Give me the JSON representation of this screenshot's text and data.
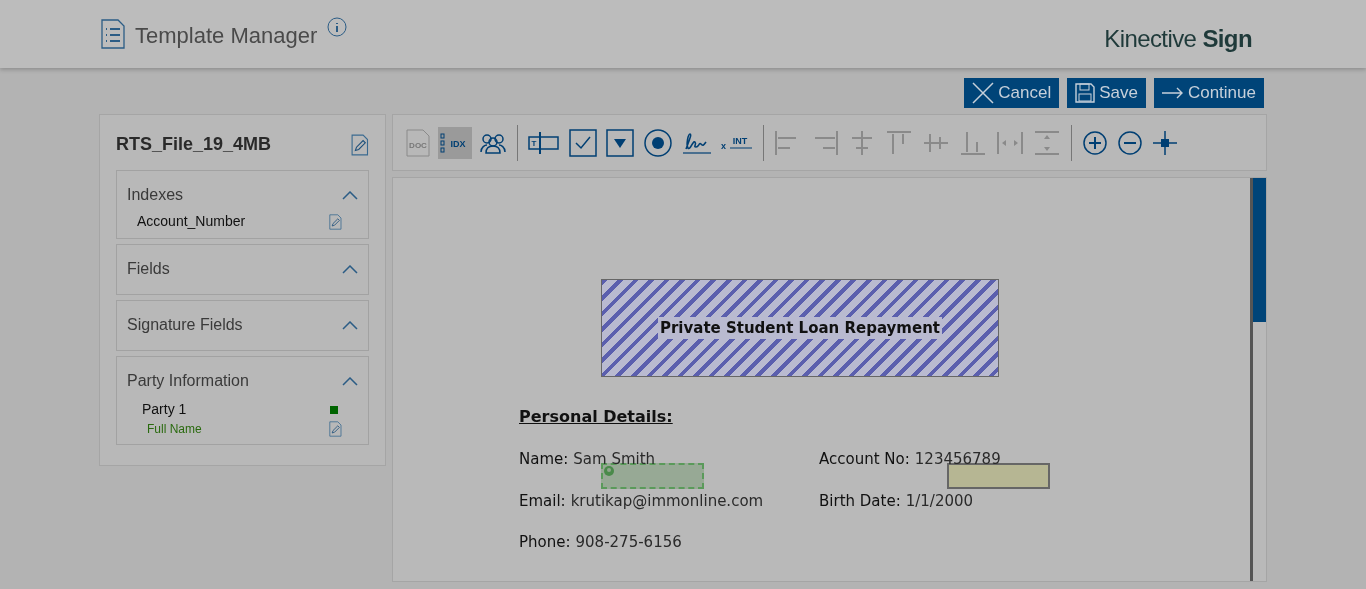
{
  "header": {
    "title": "Template Manager",
    "brand": {
      "light": "Kinective",
      "bold": "Sign"
    }
  },
  "actions": [
    {
      "kind": "cancel",
      "label": "Cancel"
    },
    {
      "kind": "save",
      "label": "Save"
    },
    {
      "kind": "continue",
      "label": "Continue"
    }
  ],
  "sidebar": {
    "file_name": "RTS_File_19_4MB",
    "sections": [
      {
        "title": "Indexes",
        "expanded": true,
        "items": [
          {
            "kind": "index",
            "label": "Account_Number"
          }
        ]
      },
      {
        "title": "Fields",
        "expanded": true
      },
      {
        "title": "Signature Fields",
        "expanded": true
      },
      {
        "title": "Party Information",
        "expanded": true,
        "items": [
          {
            "kind": "party",
            "label": "Party 1",
            "color": "#006400"
          },
          {
            "kind": "party-field",
            "label": "Full Name"
          }
        ]
      }
    ]
  },
  "toolbar": [
    [
      {
        "kind": "doc",
        "label": "DOC",
        "disabled": true,
        "selected": false
      },
      {
        "kind": "idx",
        "label": "IDX",
        "disabled": false,
        "selected": true
      },
      {
        "kind": "parties",
        "disabled": false,
        "selected": false
      }
    ],
    [
      {
        "kind": "textfield",
        "label": "T",
        "disabled": false
      },
      {
        "kind": "checkbox",
        "disabled": false
      },
      {
        "kind": "dropdown",
        "disabled": false
      },
      {
        "kind": "radio",
        "disabled": false
      },
      {
        "kind": "signature",
        "disabled": false
      },
      {
        "kind": "initials",
        "label": "INT",
        "prefix": "x",
        "disabled": false
      }
    ],
    [
      {
        "kind": "align-left",
        "disabled": true
      },
      {
        "kind": "align-right",
        "disabled": true
      },
      {
        "kind": "align-center",
        "disabled": true
      },
      {
        "kind": "align-top",
        "disabled": true
      },
      {
        "kind": "align-middle",
        "disabled": true
      },
      {
        "kind": "align-bottom",
        "disabled": true
      },
      {
        "kind": "space-h",
        "disabled": true
      },
      {
        "kind": "space-v",
        "disabled": true
      }
    ],
    [
      {
        "kind": "zoom-in",
        "disabled": false
      },
      {
        "kind": "zoom-out",
        "disabled": false
      },
      {
        "kind": "fit",
        "disabled": false
      }
    ]
  ],
  "document": {
    "title": "Private Student Loan Repayment",
    "section": "Personal Details:",
    "rows": [
      [
        {
          "label": "Name:",
          "value": "Sam Smith"
        },
        {
          "label": "Account No:",
          "value": "123456789"
        }
      ],
      [
        {
          "label": "Email:",
          "value": "krutikap@immonline.com"
        },
        {
          "label": "Birth Date:",
          "value": "1/1/2000"
        }
      ],
      [
        {
          "label": "Phone:",
          "value": "908-275-6156"
        }
      ]
    ],
    "placed_fields": [
      {
        "kind": "party",
        "color": "#8fa58c"
      },
      {
        "kind": "index",
        "color": "#b5b58a"
      }
    ]
  }
}
